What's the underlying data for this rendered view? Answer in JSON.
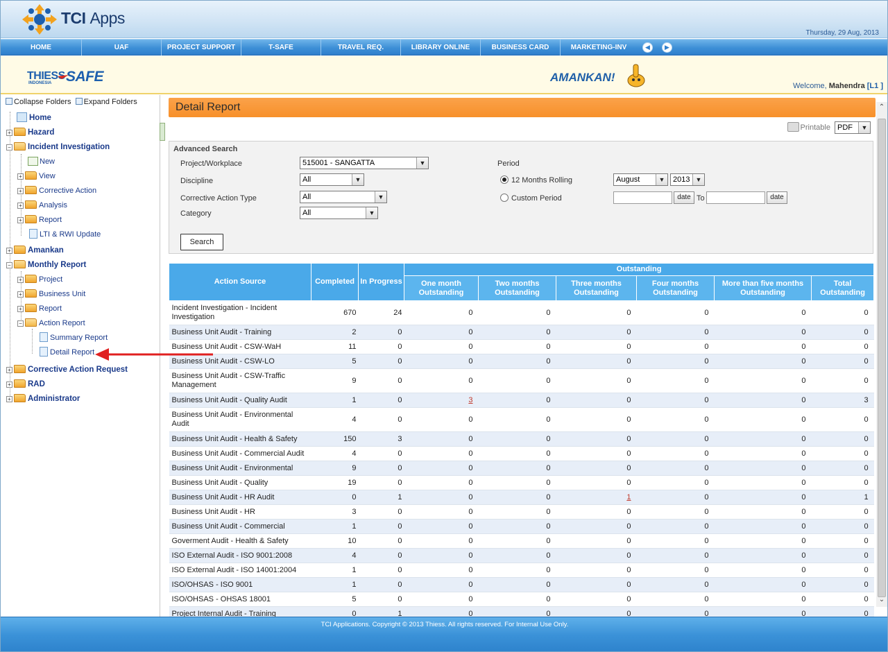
{
  "header": {
    "app_title_bold": "TCI",
    "app_title_light": "Apps",
    "date": "Thursday, 29 Aug, 2013"
  },
  "nav": {
    "items": [
      "HOME",
      "UAF",
      "PROJECT SUPPORT",
      "T-SAFE",
      "TRAVEL REQ.",
      "LIBRARY ONLINE",
      "BUSINESS CARD",
      "MARKETING-INV"
    ],
    "prev_icon": "arrow-left-circle-icon",
    "next_icon": "arrow-right-circle-icon"
  },
  "brand": {
    "logo_main": "THIESSSAFE",
    "logo_sub": "INDONESIA",
    "slogan": "AMANKAN!",
    "welcome_prefix": "Welcome,",
    "user": "Mahendra",
    "level": "[L1 ]"
  },
  "sidebar": {
    "collapse_label": "Collapse Folders",
    "expand_label": "Expand Folders",
    "tree": {
      "home": "Home",
      "hazard": "Hazard",
      "incident": "Incident Investigation",
      "inc_new": "New",
      "inc_view": "View",
      "inc_corrective": "Corrective Action",
      "inc_analysis": "Analysis",
      "inc_report": "Report",
      "inc_lti": "LTI & RWI Update",
      "amankan": "Amankan",
      "monthly": "Monthly Report",
      "m_project": "Project",
      "m_bu": "Business Unit",
      "m_report": "Report",
      "m_action": "Action Report",
      "m_summary": "Summary Report",
      "m_detail": "Detail Report",
      "car": "Corrective Action Request",
      "rad": "RAD",
      "admin": "Administrator"
    }
  },
  "main": {
    "title": "Detail Report",
    "printable": "Printable",
    "format": "PDF",
    "search": {
      "title": "Advanced Search",
      "project_label": "Project/Workplace",
      "project_value": "515001 - SANGATTA",
      "discipline_label": "Discipline",
      "discipline_value": "All",
      "cat_type_label": "Corrective Action Type",
      "cat_type_value": "All",
      "category_label": "Category",
      "category_value": "All",
      "period_label": "Period",
      "rolling_label": "12 Months Rolling",
      "month_value": "August",
      "year_value": "2013",
      "custom_label": "Custom Period",
      "date_btn": "date",
      "to_label": "To",
      "search_btn": "Search"
    },
    "table": {
      "headers": {
        "action_source": "Action Source",
        "completed": "Completed",
        "in_progress": "In Progress",
        "outstanding": "Outstanding",
        "one_month": "One month Outstanding",
        "two_months": "Two months Outstanding",
        "three_months": "Three months Outstanding",
        "four_months": "Four months Outstanding",
        "five_months": "More than five months Outstanding",
        "total": "Total Outstanding"
      },
      "rows": [
        {
          "source": "Incident Investigation - Incident Investigation",
          "c": "670",
          "p": "24",
          "o1": "0",
          "o2": "0",
          "o3": "0",
          "o4": "0",
          "o5": "0",
          "t": "0"
        },
        {
          "source": "Business Unit Audit - Training",
          "c": "2",
          "p": "0",
          "o1": "0",
          "o2": "0",
          "o3": "0",
          "o4": "0",
          "o5": "0",
          "t": "0"
        },
        {
          "source": "Business Unit Audit - CSW-WaH",
          "c": "11",
          "p": "0",
          "o1": "0",
          "o2": "0",
          "o3": "0",
          "o4": "0",
          "o5": "0",
          "t": "0"
        },
        {
          "source": "Business Unit Audit - CSW-LO",
          "c": "5",
          "p": "0",
          "o1": "0",
          "o2": "0",
          "o3": "0",
          "o4": "0",
          "o5": "0",
          "t": "0"
        },
        {
          "source": "Business Unit Audit - CSW-Traffic Management",
          "c": "9",
          "p": "0",
          "o1": "0",
          "o2": "0",
          "o3": "0",
          "o4": "0",
          "o5": "0",
          "t": "0"
        },
        {
          "source": "Business Unit Audit - Quality Audit",
          "c": "1",
          "p": "0",
          "o1": "3",
          "o2": "0",
          "o3": "0",
          "o4": "0",
          "o5": "0",
          "t": "3"
        },
        {
          "source": "Business Unit Audit - Environmental Audit",
          "c": "4",
          "p": "0",
          "o1": "0",
          "o2": "0",
          "o3": "0",
          "o4": "0",
          "o5": "0",
          "t": "0"
        },
        {
          "source": "Business Unit Audit - Health & Safety",
          "c": "150",
          "p": "3",
          "o1": "0",
          "o2": "0",
          "o3": "0",
          "o4": "0",
          "o5": "0",
          "t": "0"
        },
        {
          "source": "Business Unit Audit - Commercial Audit",
          "c": "4",
          "p": "0",
          "o1": "0",
          "o2": "0",
          "o3": "0",
          "o4": "0",
          "o5": "0",
          "t": "0"
        },
        {
          "source": "Business Unit Audit - Environmental",
          "c": "9",
          "p": "0",
          "o1": "0",
          "o2": "0",
          "o3": "0",
          "o4": "0",
          "o5": "0",
          "t": "0"
        },
        {
          "source": "Business Unit Audit - Quality",
          "c": "19",
          "p": "0",
          "o1": "0",
          "o2": "0",
          "o3": "0",
          "o4": "0",
          "o5": "0",
          "t": "0"
        },
        {
          "source": "Business Unit Audit - HR Audit",
          "c": "0",
          "p": "1",
          "o1": "0",
          "o2": "0",
          "o3": "1",
          "o4": "0",
          "o5": "0",
          "t": "1"
        },
        {
          "source": "Business Unit Audit - HR",
          "c": "3",
          "p": "0",
          "o1": "0",
          "o2": "0",
          "o3": "0",
          "o4": "0",
          "o5": "0",
          "t": "0"
        },
        {
          "source": "Business Unit Audit - Commercial",
          "c": "1",
          "p": "0",
          "o1": "0",
          "o2": "0",
          "o3": "0",
          "o4": "0",
          "o5": "0",
          "t": "0"
        },
        {
          "source": "Goverment Audit - Health & Safety",
          "c": "10",
          "p": "0",
          "o1": "0",
          "o2": "0",
          "o3": "0",
          "o4": "0",
          "o5": "0",
          "t": "0"
        },
        {
          "source": "ISO External Audit - ISO 9001:2008",
          "c": "4",
          "p": "0",
          "o1": "0",
          "o2": "0",
          "o3": "0",
          "o4": "0",
          "o5": "0",
          "t": "0"
        },
        {
          "source": "ISO External Audit - ISO 14001:2004",
          "c": "1",
          "p": "0",
          "o1": "0",
          "o2": "0",
          "o3": "0",
          "o4": "0",
          "o5": "0",
          "t": "0"
        },
        {
          "source": "ISO/OHSAS - ISO 9001",
          "c": "1",
          "p": "0",
          "o1": "0",
          "o2": "0",
          "o3": "0",
          "o4": "0",
          "o5": "0",
          "t": "0"
        },
        {
          "source": "ISO/OHSAS - OHSAS 18001",
          "c": "5",
          "p": "0",
          "o1": "0",
          "o2": "0",
          "o3": "0",
          "o4": "0",
          "o5": "0",
          "t": "0"
        },
        {
          "source": "Project Internal Audit - Training",
          "c": "0",
          "p": "1",
          "o1": "0",
          "o2": "0",
          "o3": "0",
          "o4": "0",
          "o5": "0",
          "t": "0"
        }
      ]
    }
  },
  "footer": {
    "text": "TCI Applications. Copyright © 2013 Thiess. All rights reserved. For Internal Use Only."
  },
  "colors": {
    "nav_blue": "#3d8fd6",
    "title_orange": "#f7902a",
    "table_header": "#4aa9e9",
    "link_red": "#c0392b",
    "annotation_arrow": "#e02020"
  }
}
